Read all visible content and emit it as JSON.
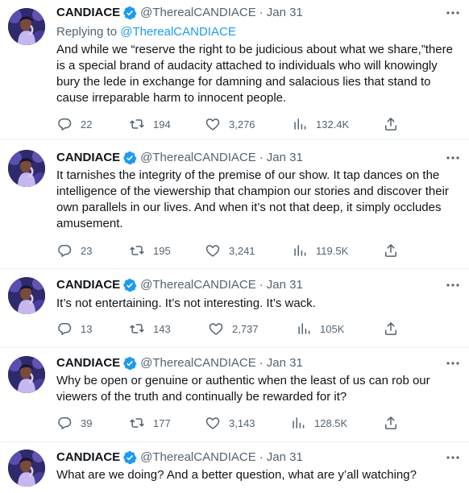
{
  "colors": {
    "text": "#0f1419",
    "secondary": "#536471",
    "accent": "#1d9bf0",
    "verified": "#1d9bf0",
    "divider": "#eff3f4"
  },
  "tweets": [
    {
      "display_name": "CANDIACE",
      "handle": "@TherealCANDIACE",
      "dot": "·",
      "date": "Jan 31",
      "replying_prefix": "Replying to ",
      "replying_mention": "@TherealCANDIACE",
      "text": "And while we “reserve the right to be judicious about what we share,”there is a special brand of audacity attached to individuals who will knowingly bury the lede in exchange for damning and salacious lies that stand to cause irreparable harm to innocent people.",
      "replies": "22",
      "retweets": "194",
      "likes": "3,276",
      "views": "132.4K"
    },
    {
      "display_name": "CANDIACE",
      "handle": "@TherealCANDIACE",
      "dot": "·",
      "date": "Jan 31",
      "text": "It tarnishes the integrity of the premise of our show. It tap dances on the intelligence of the viewership that champion our stories and discover their own parallels in our lives. And when it’s not that deep, it simply occludes amusement.",
      "replies": "23",
      "retweets": "195",
      "likes": "3,241",
      "views": "119.5K"
    },
    {
      "display_name": "CANDIACE",
      "handle": "@TherealCANDIACE",
      "dot": "·",
      "date": "Jan 31",
      "text": "It’s not entertaining. It’s not interesting. It’s wack.",
      "replies": "13",
      "retweets": "143",
      "likes": "2,737",
      "views": "105K"
    },
    {
      "display_name": "CANDIACE",
      "handle": "@TherealCANDIACE",
      "dot": "·",
      "date": "Jan 31",
      "text": "Why be open or genuine or authentic when the least of us can rob our viewers of the truth and continually be rewarded for it?",
      "replies": "39",
      "retweets": "177",
      "likes": "3,143",
      "views": "128.5K"
    },
    {
      "display_name": "CANDIACE",
      "handle": "@TherealCANDIACE",
      "dot": "·",
      "date": "Jan 31",
      "text": "What are we doing? And a better question, what are y’all watching?"
    }
  ]
}
